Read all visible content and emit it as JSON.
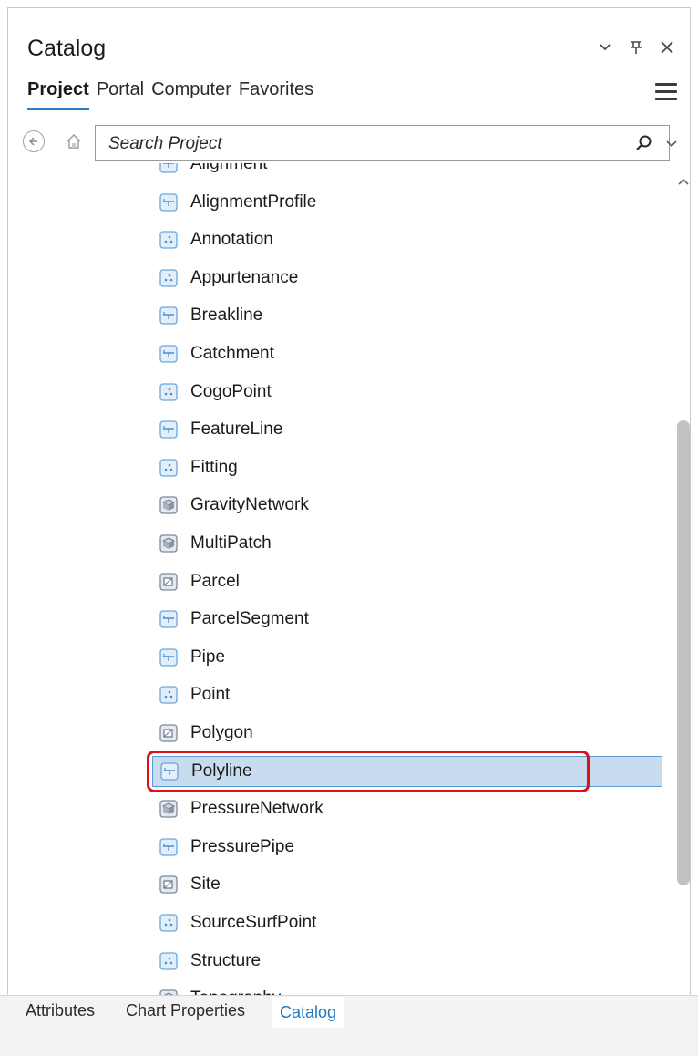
{
  "header": {
    "title": "Catalog"
  },
  "tabs": [
    "Project",
    "Portal",
    "Computer",
    "Favorites"
  ],
  "active_tab": "Project",
  "search": {
    "placeholder": "Search Project"
  },
  "items": [
    {
      "label": "Alignment",
      "icon": "line-fc-icon"
    },
    {
      "label": "AlignmentProfile",
      "icon": "line-fc-icon"
    },
    {
      "label": "Annotation",
      "icon": "point-fc-icon"
    },
    {
      "label": "Appurtenance",
      "icon": "point-fc-icon"
    },
    {
      "label": "Breakline",
      "icon": "line-fc-icon"
    },
    {
      "label": "Catchment",
      "icon": "line-fc-icon"
    },
    {
      "label": "CogoPoint",
      "icon": "point-fc-icon"
    },
    {
      "label": "FeatureLine",
      "icon": "line-fc-icon"
    },
    {
      "label": "Fitting",
      "icon": "point-fc-icon"
    },
    {
      "label": "GravityNetwork",
      "icon": "multipatch-fc-icon"
    },
    {
      "label": "MultiPatch",
      "icon": "multipatch-fc-icon"
    },
    {
      "label": "Parcel",
      "icon": "polygon-fc-icon"
    },
    {
      "label": "ParcelSegment",
      "icon": "line-fc-icon"
    },
    {
      "label": "Pipe",
      "icon": "line-fc-icon"
    },
    {
      "label": "Point",
      "icon": "point-fc-icon"
    },
    {
      "label": "Polygon",
      "icon": "polygon-fc-icon"
    },
    {
      "label": "Polyline",
      "icon": "line-fc-icon",
      "selected": true
    },
    {
      "label": "PressureNetwork",
      "icon": "multipatch-fc-icon"
    },
    {
      "label": "PressurePipe",
      "icon": "line-fc-icon"
    },
    {
      "label": "Site",
      "icon": "polygon-fc-icon"
    },
    {
      "label": "SourceSurfPoint",
      "icon": "point-fc-icon"
    },
    {
      "label": "Structure",
      "icon": "point-fc-icon"
    },
    {
      "label": "Topography",
      "icon": "multipatch-fc-icon"
    }
  ],
  "bottom_tabs": [
    "Attributes",
    "Chart Properties",
    "Catalog"
  ],
  "active_bottom_tab": "Catalog",
  "colors": {
    "accent": "#2b7bcb",
    "selection": "#c8dcf0",
    "highlight_box": "#e0101b"
  }
}
